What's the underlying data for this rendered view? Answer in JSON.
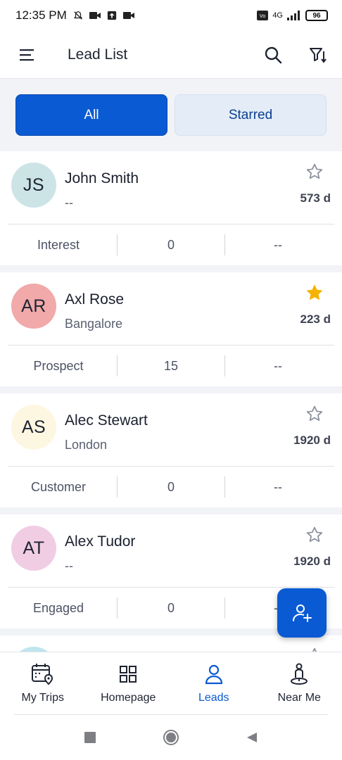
{
  "status_bar": {
    "time": "12:35 PM",
    "network": "4G",
    "battery": "96"
  },
  "app_bar": {
    "title": "Lead List"
  },
  "tabs": {
    "all_label": "All",
    "starred_label": "Starred",
    "active": "All"
  },
  "leads": [
    {
      "initials": "JS",
      "name": "John Smith",
      "location": "--",
      "days": "573 d",
      "starred": false,
      "avatar_color": "#cde4e6",
      "stage": "Interest",
      "count": "0",
      "extra": "--"
    },
    {
      "initials": "AR",
      "name": "Axl Rose",
      "location": "Bangalore",
      "days": "223 d",
      "starred": true,
      "avatar_color": "#f1a9a9",
      "stage": "Prospect",
      "count": "15",
      "extra": "--"
    },
    {
      "initials": "AS",
      "name": "Alec Stewart",
      "location": "London",
      "days": "1920 d",
      "starred": false,
      "avatar_color": "#fdf6e1",
      "stage": "Customer",
      "count": "0",
      "extra": "--"
    },
    {
      "initials": "AT",
      "name": "Alex Tudor",
      "location": "--",
      "days": "1920 d",
      "starred": false,
      "avatar_color": "#f1cde3",
      "stage": "Engaged",
      "count": "0",
      "extra": "--"
    }
  ],
  "bottom_nav": {
    "items": [
      {
        "label": "My Trips",
        "icon": "calendar-location-icon"
      },
      {
        "label": "Homepage",
        "icon": "grid-icon"
      },
      {
        "label": "Leads",
        "icon": "person-icon"
      },
      {
        "label": "Near Me",
        "icon": "person-pin-icon"
      }
    ],
    "active": "Leads"
  },
  "colors": {
    "primary": "#0a5ad3",
    "star_active": "#f5b301",
    "star_inactive": "#8a8f9c"
  }
}
